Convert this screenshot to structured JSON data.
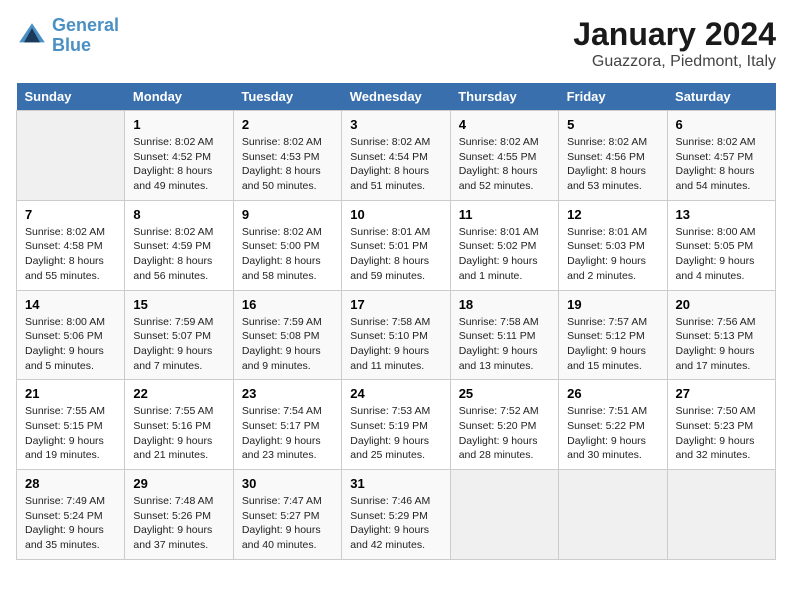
{
  "header": {
    "logo_line1": "General",
    "logo_line2": "Blue",
    "title": "January 2024",
    "subtitle": "Guazzora, Piedmont, Italy"
  },
  "days_of_week": [
    "Sunday",
    "Monday",
    "Tuesday",
    "Wednesday",
    "Thursday",
    "Friday",
    "Saturday"
  ],
  "weeks": [
    [
      {
        "day": "",
        "info": []
      },
      {
        "day": "1",
        "info": [
          "Sunrise: 8:02 AM",
          "Sunset: 4:52 PM",
          "Daylight: 8 hours",
          "and 49 minutes."
        ]
      },
      {
        "day": "2",
        "info": [
          "Sunrise: 8:02 AM",
          "Sunset: 4:53 PM",
          "Daylight: 8 hours",
          "and 50 minutes."
        ]
      },
      {
        "day": "3",
        "info": [
          "Sunrise: 8:02 AM",
          "Sunset: 4:54 PM",
          "Daylight: 8 hours",
          "and 51 minutes."
        ]
      },
      {
        "day": "4",
        "info": [
          "Sunrise: 8:02 AM",
          "Sunset: 4:55 PM",
          "Daylight: 8 hours",
          "and 52 minutes."
        ]
      },
      {
        "day": "5",
        "info": [
          "Sunrise: 8:02 AM",
          "Sunset: 4:56 PM",
          "Daylight: 8 hours",
          "and 53 minutes."
        ]
      },
      {
        "day": "6",
        "info": [
          "Sunrise: 8:02 AM",
          "Sunset: 4:57 PM",
          "Daylight: 8 hours",
          "and 54 minutes."
        ]
      }
    ],
    [
      {
        "day": "7",
        "info": [
          "Sunrise: 8:02 AM",
          "Sunset: 4:58 PM",
          "Daylight: 8 hours",
          "and 55 minutes."
        ]
      },
      {
        "day": "8",
        "info": [
          "Sunrise: 8:02 AM",
          "Sunset: 4:59 PM",
          "Daylight: 8 hours",
          "and 56 minutes."
        ]
      },
      {
        "day": "9",
        "info": [
          "Sunrise: 8:02 AM",
          "Sunset: 5:00 PM",
          "Daylight: 8 hours",
          "and 58 minutes."
        ]
      },
      {
        "day": "10",
        "info": [
          "Sunrise: 8:01 AM",
          "Sunset: 5:01 PM",
          "Daylight: 8 hours",
          "and 59 minutes."
        ]
      },
      {
        "day": "11",
        "info": [
          "Sunrise: 8:01 AM",
          "Sunset: 5:02 PM",
          "Daylight: 9 hours",
          "and 1 minute."
        ]
      },
      {
        "day": "12",
        "info": [
          "Sunrise: 8:01 AM",
          "Sunset: 5:03 PM",
          "Daylight: 9 hours",
          "and 2 minutes."
        ]
      },
      {
        "day": "13",
        "info": [
          "Sunrise: 8:00 AM",
          "Sunset: 5:05 PM",
          "Daylight: 9 hours",
          "and 4 minutes."
        ]
      }
    ],
    [
      {
        "day": "14",
        "info": [
          "Sunrise: 8:00 AM",
          "Sunset: 5:06 PM",
          "Daylight: 9 hours",
          "and 5 minutes."
        ]
      },
      {
        "day": "15",
        "info": [
          "Sunrise: 7:59 AM",
          "Sunset: 5:07 PM",
          "Daylight: 9 hours",
          "and 7 minutes."
        ]
      },
      {
        "day": "16",
        "info": [
          "Sunrise: 7:59 AM",
          "Sunset: 5:08 PM",
          "Daylight: 9 hours",
          "and 9 minutes."
        ]
      },
      {
        "day": "17",
        "info": [
          "Sunrise: 7:58 AM",
          "Sunset: 5:10 PM",
          "Daylight: 9 hours",
          "and 11 minutes."
        ]
      },
      {
        "day": "18",
        "info": [
          "Sunrise: 7:58 AM",
          "Sunset: 5:11 PM",
          "Daylight: 9 hours",
          "and 13 minutes."
        ]
      },
      {
        "day": "19",
        "info": [
          "Sunrise: 7:57 AM",
          "Sunset: 5:12 PM",
          "Daylight: 9 hours",
          "and 15 minutes."
        ]
      },
      {
        "day": "20",
        "info": [
          "Sunrise: 7:56 AM",
          "Sunset: 5:13 PM",
          "Daylight: 9 hours",
          "and 17 minutes."
        ]
      }
    ],
    [
      {
        "day": "21",
        "info": [
          "Sunrise: 7:55 AM",
          "Sunset: 5:15 PM",
          "Daylight: 9 hours",
          "and 19 minutes."
        ]
      },
      {
        "day": "22",
        "info": [
          "Sunrise: 7:55 AM",
          "Sunset: 5:16 PM",
          "Daylight: 9 hours",
          "and 21 minutes."
        ]
      },
      {
        "day": "23",
        "info": [
          "Sunrise: 7:54 AM",
          "Sunset: 5:17 PM",
          "Daylight: 9 hours",
          "and 23 minutes."
        ]
      },
      {
        "day": "24",
        "info": [
          "Sunrise: 7:53 AM",
          "Sunset: 5:19 PM",
          "Daylight: 9 hours",
          "and 25 minutes."
        ]
      },
      {
        "day": "25",
        "info": [
          "Sunrise: 7:52 AM",
          "Sunset: 5:20 PM",
          "Daylight: 9 hours",
          "and 28 minutes."
        ]
      },
      {
        "day": "26",
        "info": [
          "Sunrise: 7:51 AM",
          "Sunset: 5:22 PM",
          "Daylight: 9 hours",
          "and 30 minutes."
        ]
      },
      {
        "day": "27",
        "info": [
          "Sunrise: 7:50 AM",
          "Sunset: 5:23 PM",
          "Daylight: 9 hours",
          "and 32 minutes."
        ]
      }
    ],
    [
      {
        "day": "28",
        "info": [
          "Sunrise: 7:49 AM",
          "Sunset: 5:24 PM",
          "Daylight: 9 hours",
          "and 35 minutes."
        ]
      },
      {
        "day": "29",
        "info": [
          "Sunrise: 7:48 AM",
          "Sunset: 5:26 PM",
          "Daylight: 9 hours",
          "and 37 minutes."
        ]
      },
      {
        "day": "30",
        "info": [
          "Sunrise: 7:47 AM",
          "Sunset: 5:27 PM",
          "Daylight: 9 hours",
          "and 40 minutes."
        ]
      },
      {
        "day": "31",
        "info": [
          "Sunrise: 7:46 AM",
          "Sunset: 5:29 PM",
          "Daylight: 9 hours",
          "and 42 minutes."
        ]
      },
      {
        "day": "",
        "info": []
      },
      {
        "day": "",
        "info": []
      },
      {
        "day": "",
        "info": []
      }
    ]
  ]
}
